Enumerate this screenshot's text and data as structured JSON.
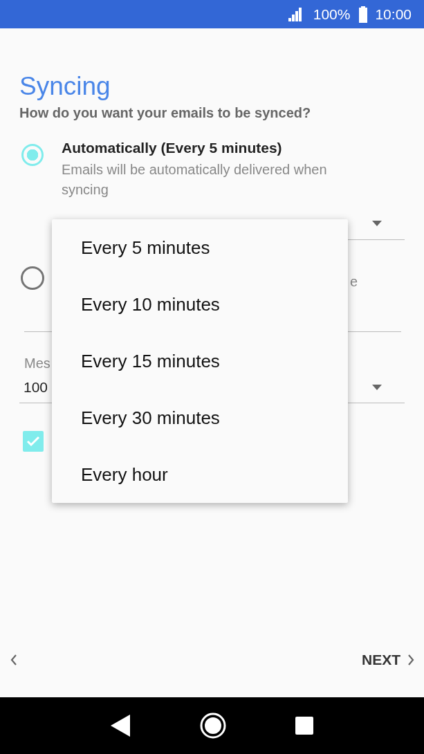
{
  "status_bar": {
    "battery": "100%",
    "time": "10:00"
  },
  "title": "Syncing",
  "subtitle": "How do you want your emails to be synced?",
  "options": [
    {
      "label": "Automatically (Every 5 minutes)",
      "description": "Emails will be automatically delivered when syncing",
      "selected": true
    },
    {
      "label": "e",
      "selected": false
    }
  ],
  "message_field": {
    "label": "Mes",
    "value": "100"
  },
  "checkbox": {
    "checked": true
  },
  "menu": {
    "items": [
      {
        "label": "Every 5 minutes"
      },
      {
        "label": "Every 10 minutes"
      },
      {
        "label": "Every 15 minutes"
      },
      {
        "label": "Every 30 minutes"
      },
      {
        "label": "Every hour"
      }
    ]
  },
  "footer": {
    "next": "NEXT"
  }
}
